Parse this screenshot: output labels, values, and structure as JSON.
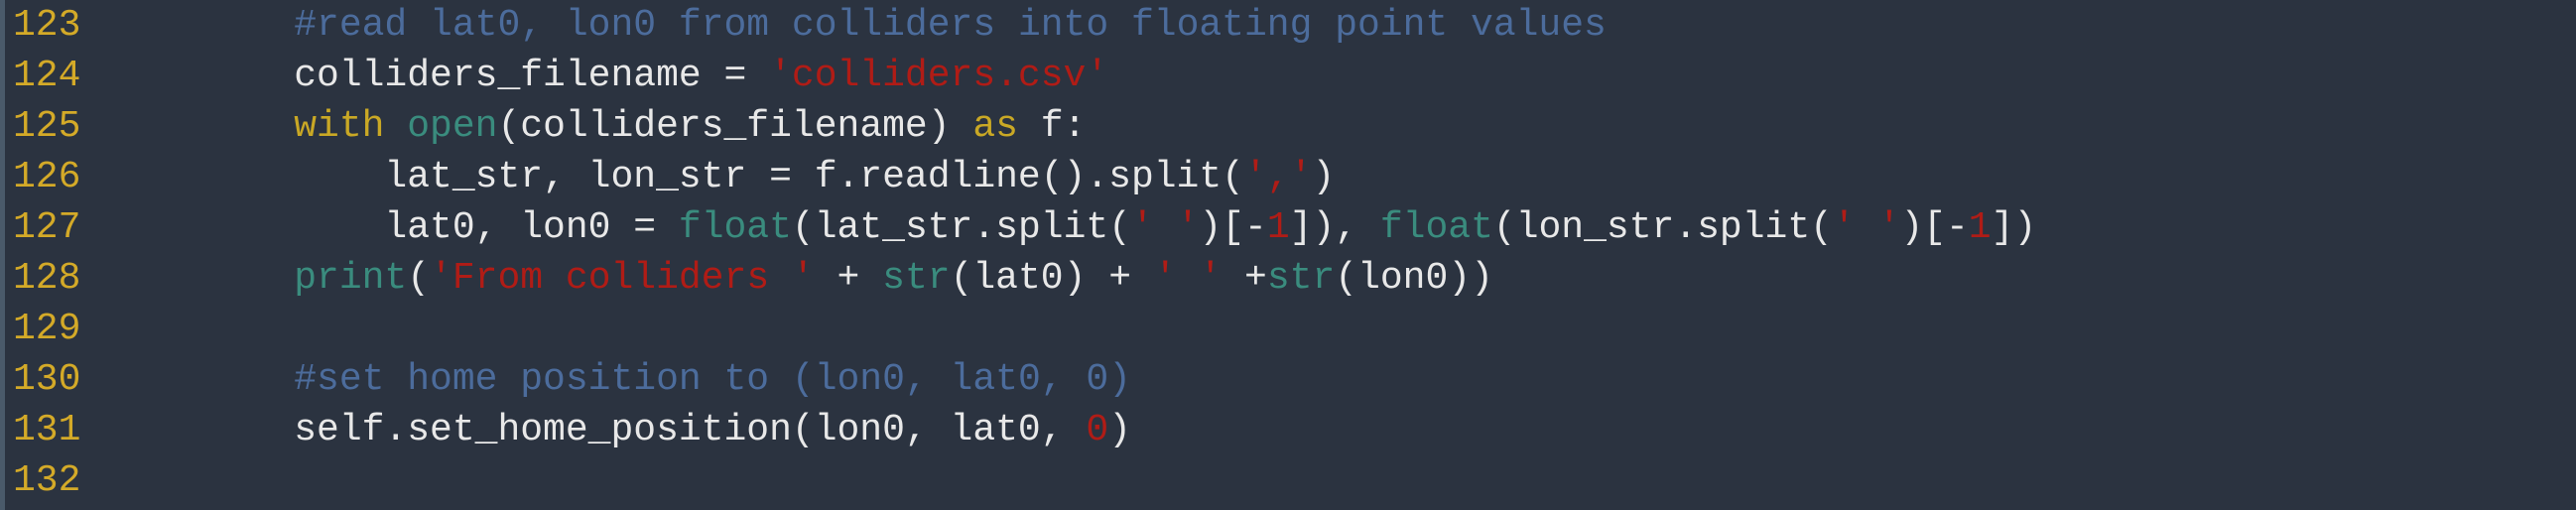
{
  "editor": {
    "colors": {
      "background": "#2b3340",
      "line_number": "#d4aa28",
      "comment": "#4c6c9c",
      "string": "#b01c16",
      "keyword": "#c9a825",
      "builtin": "#3a8c7e",
      "plain": "#e8e8e8"
    },
    "lines": [
      {
        "number": "123",
        "tokens": [
          {
            "type": "plain",
            "text": "    "
          },
          {
            "type": "comment",
            "text": "#read lat0, lon0 from colliders into floating point values"
          }
        ]
      },
      {
        "number": "124",
        "tokens": [
          {
            "type": "plain",
            "text": "    colliders_filename = "
          },
          {
            "type": "string",
            "text": "'colliders.csv'"
          }
        ]
      },
      {
        "number": "125",
        "tokens": [
          {
            "type": "plain",
            "text": "    "
          },
          {
            "type": "keyword",
            "text": "with"
          },
          {
            "type": "plain",
            "text": " "
          },
          {
            "type": "builtin",
            "text": "open"
          },
          {
            "type": "plain",
            "text": "(colliders_filename) "
          },
          {
            "type": "keyword",
            "text": "as"
          },
          {
            "type": "plain",
            "text": " f:"
          }
        ]
      },
      {
        "number": "126",
        "tokens": [
          {
            "type": "plain",
            "text": "        lat_str, lon_str = f.readline().split("
          },
          {
            "type": "string",
            "text": "','"
          },
          {
            "type": "plain",
            "text": ")"
          }
        ]
      },
      {
        "number": "127",
        "tokens": [
          {
            "type": "plain",
            "text": "        lat0, lon0 = "
          },
          {
            "type": "builtin",
            "text": "float"
          },
          {
            "type": "plain",
            "text": "(lat_str.split("
          },
          {
            "type": "string",
            "text": "' '"
          },
          {
            "type": "plain",
            "text": ")[-"
          },
          {
            "type": "number",
            "text": "1"
          },
          {
            "type": "plain",
            "text": "]), "
          },
          {
            "type": "builtin",
            "text": "float"
          },
          {
            "type": "plain",
            "text": "(lon_str.split("
          },
          {
            "type": "string",
            "text": "' '"
          },
          {
            "type": "plain",
            "text": ")[-"
          },
          {
            "type": "number",
            "text": "1"
          },
          {
            "type": "plain",
            "text": "])"
          }
        ]
      },
      {
        "number": "128",
        "tokens": [
          {
            "type": "plain",
            "text": "    "
          },
          {
            "type": "builtin",
            "text": "print"
          },
          {
            "type": "plain",
            "text": "("
          },
          {
            "type": "string",
            "text": "'From colliders '"
          },
          {
            "type": "plain",
            "text": " + "
          },
          {
            "type": "builtin",
            "text": "str"
          },
          {
            "type": "plain",
            "text": "(lat0) + "
          },
          {
            "type": "string",
            "text": "' '"
          },
          {
            "type": "plain",
            "text": " +"
          },
          {
            "type": "builtin",
            "text": "str"
          },
          {
            "type": "plain",
            "text": "(lon0))"
          }
        ]
      },
      {
        "number": "129",
        "tokens": []
      },
      {
        "number": "130",
        "tokens": [
          {
            "type": "plain",
            "text": "    "
          },
          {
            "type": "comment",
            "text": "#set home position to (lon0, lat0, 0)"
          }
        ]
      },
      {
        "number": "131",
        "tokens": [
          {
            "type": "plain",
            "text": "    self.set_home_position(lon0, lat0, "
          },
          {
            "type": "number",
            "text": "0"
          },
          {
            "type": "plain",
            "text": ")"
          }
        ]
      },
      {
        "number": "132",
        "tokens": []
      }
    ]
  }
}
